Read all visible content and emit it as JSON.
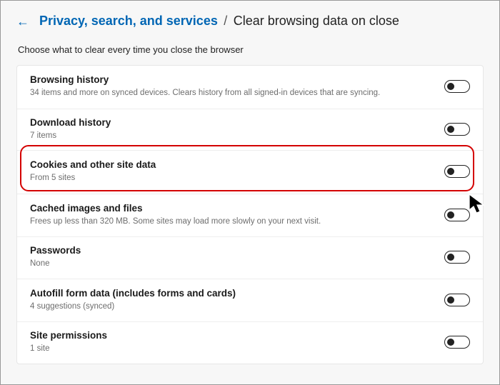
{
  "breadcrumb": {
    "parent": "Privacy, search, and services",
    "separator": "/",
    "current": "Clear browsing data on close"
  },
  "intro": "Choose what to clear every time you close the browser",
  "settings": [
    {
      "title": "Browsing history",
      "sub": "34 items and more on synced devices. Clears history from all signed-in devices that are syncing.",
      "on": false
    },
    {
      "title": "Download history",
      "sub": "7 items",
      "on": false
    },
    {
      "title": "Cookies and other site data",
      "sub": "From 5 sites",
      "on": false
    },
    {
      "title": "Cached images and files",
      "sub": "Frees up less than 320 MB. Some sites may load more slowly on your next visit.",
      "on": false
    },
    {
      "title": "Passwords",
      "sub": "None",
      "on": false
    },
    {
      "title": "Autofill form data (includes forms and cards)",
      "sub": "4 suggestions (synced)",
      "on": false
    },
    {
      "title": "Site permissions",
      "sub": "1 site",
      "on": false
    }
  ]
}
